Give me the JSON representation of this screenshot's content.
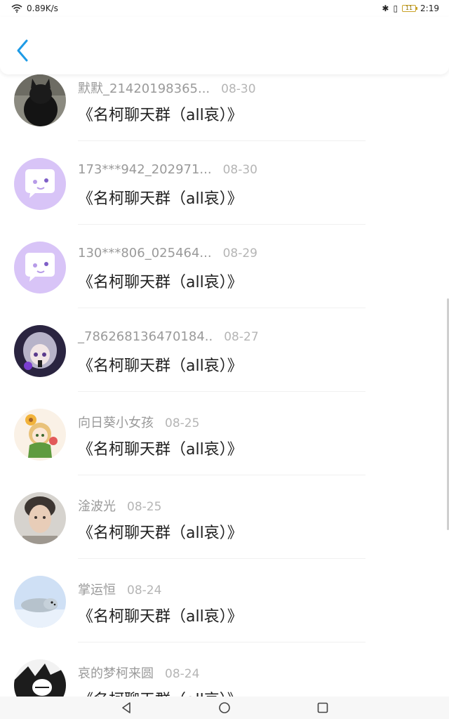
{
  "status_bar": {
    "speed": "0.89K/s",
    "battery": "11",
    "time": "2:19"
  },
  "header": {
    "back_icon": "chevron-left-icon"
  },
  "items": [
    {
      "name": "默默_21420198365...",
      "date": "08-30",
      "message": "《名柯聊天群（all哀）》",
      "avatar": "black-cat"
    },
    {
      "name": "173***942_202971...",
      "date": "08-30",
      "message": "《名柯聊天群（all哀）》",
      "avatar": "default-bubble"
    },
    {
      "name": "130***806_025464...",
      "date": "08-29",
      "message": "《名柯聊天群（all哀）》",
      "avatar": "default-bubble"
    },
    {
      "name": "_786268136470184..",
      "date": "08-27",
      "message": "《名柯聊天群（all哀）》",
      "avatar": "anime-purple"
    },
    {
      "name": "向日葵小女孩",
      "date": "08-25",
      "message": "《名柯聊天群（all哀）》",
      "avatar": "anime-sunflower"
    },
    {
      "name": "淦波光",
      "date": "08-25",
      "message": "《名柯聊天群（all哀）》",
      "avatar": "photo-boy"
    },
    {
      "name": "掌运恒",
      "date": "08-24",
      "message": "《名柯聊天群（all哀）》",
      "avatar": "seal"
    },
    {
      "name": "哀的梦柯来圆",
      "date": "08-24",
      "message": "《名柯聊天群（all哀）》",
      "avatar": "manga-bw"
    }
  ],
  "colors": {
    "accent": "#1e9be6",
    "default_avatar_bg": "#d8c4f7"
  }
}
